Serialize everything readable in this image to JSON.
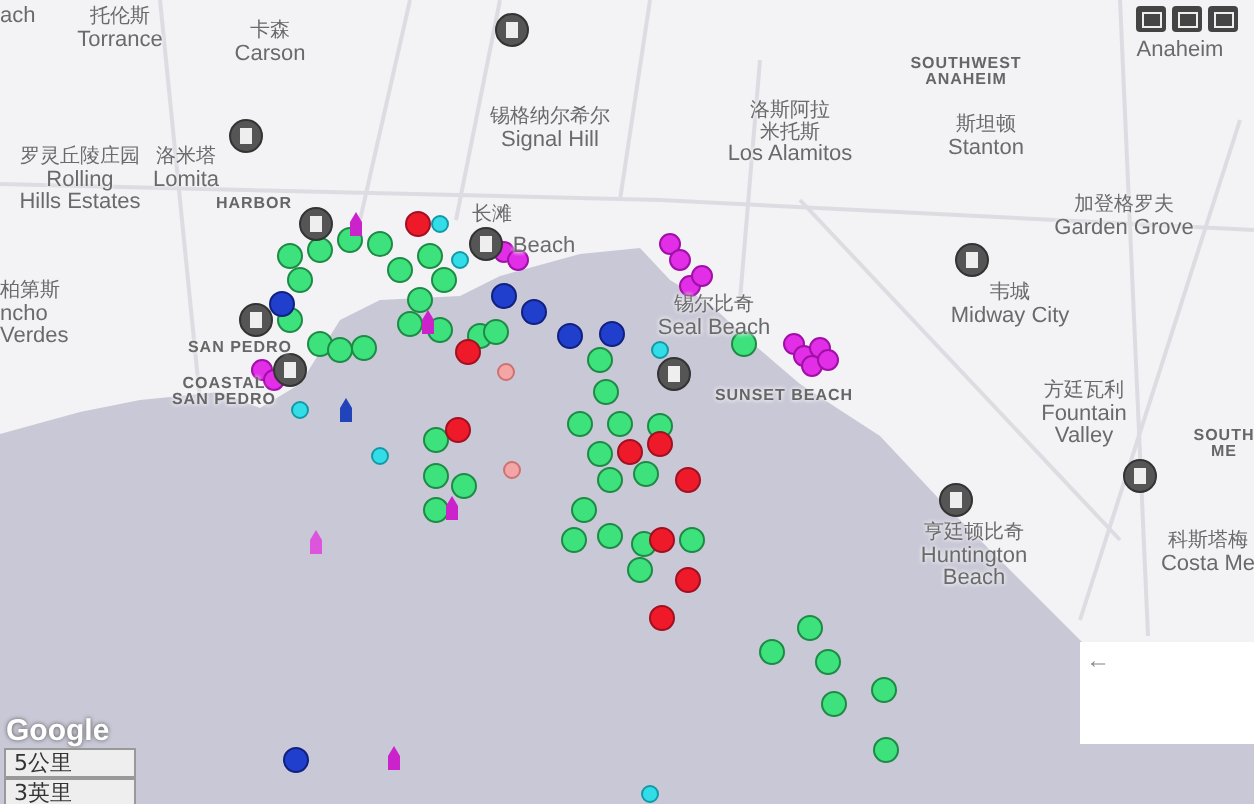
{
  "places": [
    {
      "kind": "city",
      "lines": [
        "ach"
      ]
    },
    {
      "kind": "city",
      "lines": [
        "托伦斯",
        "Torrance"
      ]
    },
    {
      "kind": "city",
      "lines": [
        "卡森",
        "Carson"
      ]
    },
    {
      "kind": "city",
      "lines": [
        "锡格纳尔希尔",
        "Signal Hill"
      ]
    },
    {
      "kind": "city",
      "lines": [
        "罗灵丘陵庄园",
        "Rolling",
        "Hills Estates"
      ]
    },
    {
      "kind": "city",
      "lines": [
        "洛米塔",
        "Lomita"
      ]
    },
    {
      "kind": "district",
      "lines": [
        "HARBOR"
      ]
    },
    {
      "kind": "city",
      "lines": [
        "长滩"
      ]
    },
    {
      "kind": "city",
      "lines": [
        "Beach"
      ]
    },
    {
      "kind": "city",
      "lines": [
        "柏第斯",
        "ncho",
        "Verdes"
      ]
    },
    {
      "kind": "district",
      "lines": [
        "SAN PEDRO"
      ]
    },
    {
      "kind": "district",
      "lines": [
        "COASTAL",
        "SAN PEDRO"
      ]
    },
    {
      "kind": "city",
      "lines": [
        "洛斯阿拉",
        "米托斯",
        "Los Alamitos"
      ]
    },
    {
      "kind": "district",
      "lines": [
        "SOUTHWEST",
        "ANAHEIM"
      ]
    },
    {
      "kind": "city",
      "lines": [
        "斯坦顿",
        "Stanton"
      ]
    },
    {
      "kind": "city",
      "lines": [
        "Anaheim"
      ]
    },
    {
      "kind": "city",
      "lines": [
        "加登格罗夫",
        "Garden Grove"
      ]
    },
    {
      "kind": "city",
      "lines": [
        "锡尔比奇",
        "Seal Beach"
      ]
    },
    {
      "kind": "city",
      "lines": [
        "韦城",
        "Midway City"
      ]
    },
    {
      "kind": "district",
      "lines": [
        "SUNSET BEACH"
      ]
    },
    {
      "kind": "city",
      "lines": [
        "方廷瓦利",
        "Fountain",
        "Valley"
      ]
    },
    {
      "kind": "district",
      "lines": [
        "SOUTH",
        "ME"
      ]
    },
    {
      "kind": "city",
      "lines": [
        "亨廷顿比奇",
        "Huntington",
        "Beach"
      ]
    },
    {
      "kind": "city",
      "lines": [
        "科斯塔梅",
        "Costa Me"
      ]
    }
  ],
  "attribution": "Google",
  "scale": [
    "5公里",
    "3英里"
  ],
  "panel": {
    "collapse": "←"
  }
}
